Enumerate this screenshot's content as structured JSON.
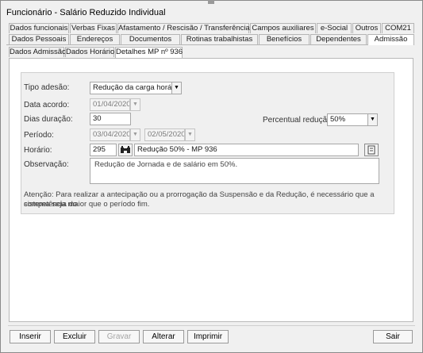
{
  "window": {
    "title": "Funcionário - Salário Reduzido Individual"
  },
  "tabs_row1": [
    "Dados funcionais",
    "Verbas Fixas",
    "Afastamento / Rescisão / Transferência",
    "Campos auxiliares",
    "e-Social",
    "Outros",
    "COM21"
  ],
  "tabs_row2": [
    "Dados Pessoais",
    "Endereços",
    "Documentos",
    "Rotinas trabalhistas",
    "Benefícios",
    "Dependentes",
    "Admissão"
  ],
  "tabs_row3": [
    "Dados Admissão",
    "Dados Horário",
    "Detalhes MP nº 936"
  ],
  "form": {
    "tipo_adesao_label": "Tipo adesão:",
    "tipo_adesao_value": "Redução da carga horária",
    "data_acordo_label": "Data acordo:",
    "data_acordo_value": "01/04/2020",
    "dias_duracao_label": "Dias duração:",
    "dias_duracao_value": "30",
    "percentual_label": "Percentual redução:",
    "percentual_value": "50%",
    "periodo_label": "Período:",
    "periodo_inicio": "03/04/2020",
    "periodo_fim": "02/05/2020",
    "horario_label": "Horário:",
    "horario_codigo": "295",
    "horario_descricao": "Redução 50% - MP 936",
    "observacao_label": "Observação:",
    "observacao_value": "Redução de Jornada e de salário em 50%.",
    "atencao_line1": "Atenção: Para realizar a antecipação ou a prorrogação da Suspensão e da Redução, é necessário que a competência do",
    "atencao_line2": "sistema seja maior que o período fim."
  },
  "buttons": {
    "inserir": "Inserir",
    "excluir": "Excluir",
    "gravar": "Gravar",
    "alterar": "Alterar",
    "imprimir": "Imprimir",
    "sair": "Sair"
  },
  "icons": {
    "dropdown": "chevron-down-icon",
    "search": "binoculars-icon",
    "lookup": "document-lookup-icon"
  }
}
